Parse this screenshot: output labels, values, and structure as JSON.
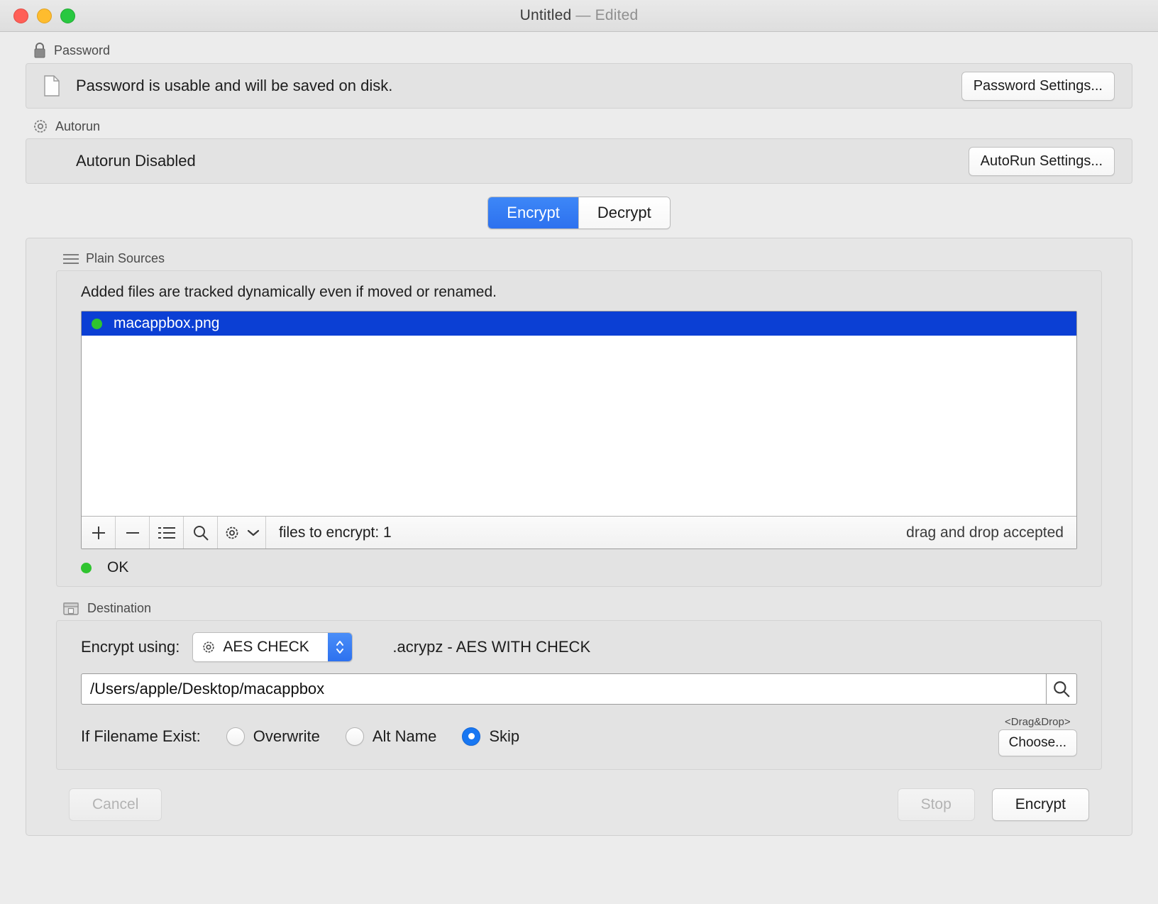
{
  "window": {
    "title": "Untitled",
    "title_separator": " — ",
    "title_state": "Edited",
    "traffic": {
      "close": "close-button",
      "minimize": "minimize-button",
      "zoom": "zoom-button"
    }
  },
  "password": {
    "section_label": "Password",
    "status_text": "Password is usable and will be saved on disk.",
    "settings_button": "Password Settings..."
  },
  "autorun": {
    "section_label": "Autorun",
    "status_text": "Autorun Disabled",
    "settings_button": "AutoRun Settings..."
  },
  "mode_tabs": {
    "encrypt": "Encrypt",
    "decrypt": "Decrypt",
    "active": "Encrypt",
    "active_color": "#2d71ef"
  },
  "plain_sources": {
    "section_label": "Plain Sources",
    "hint": "Added files are tracked dynamically  even if moved or renamed.",
    "files": [
      {
        "name": "macappbox.png",
        "status_color": "#2fc42f",
        "selected": true
      }
    ],
    "selection_color": "#0b3fd4",
    "toolbar": {
      "add": "+",
      "remove": "−",
      "list": "list-icon",
      "search": "search-icon",
      "gear": "gear-icon",
      "chevron": "chevron-down-icon",
      "count_text": "files to encrypt: 1",
      "drop_text": "drag and drop accepted"
    },
    "status": {
      "text": "OK",
      "color": "#2fc42f"
    }
  },
  "destination": {
    "section_label": "Destination",
    "encrypt_using_label": "Encrypt using:",
    "method_value": "AES CHECK",
    "method_icon": "gear-icon",
    "extension_text": ".acrypz - AES WITH CHECK",
    "path_value": "/Users/apple/Desktop/macappbox",
    "path_placeholder": "/Users/apple/Desktop/macappbox",
    "search_icon": "search-icon",
    "filename_exist_label": "If Filename Exist:",
    "options": [
      {
        "label": "Overwrite",
        "selected": false
      },
      {
        "label": "Alt Name",
        "selected": false
      },
      {
        "label": "Skip",
        "selected": true
      }
    ],
    "dragdrop_label": "<Drag&Drop>",
    "choose_button": "Choose..."
  },
  "footer": {
    "cancel": "Cancel",
    "cancel_disabled": true,
    "stop": "Stop",
    "stop_disabled": true,
    "encrypt": "Encrypt",
    "encrypt_disabled": false
  }
}
